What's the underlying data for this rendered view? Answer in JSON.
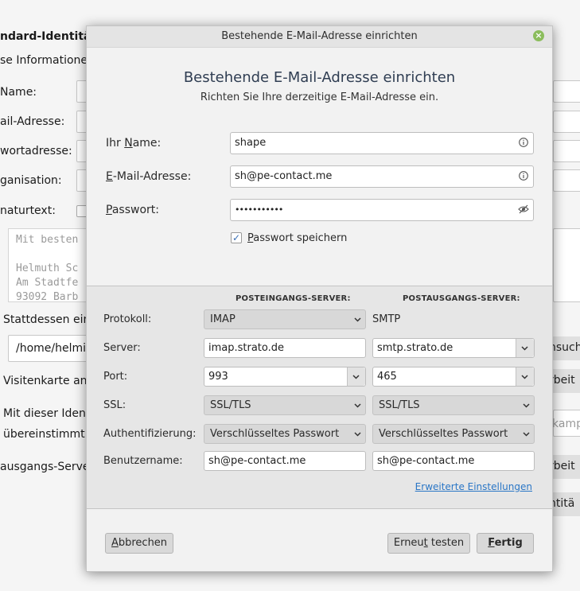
{
  "background": {
    "section_title": "ndard-Identitä",
    "section_subtitle": "se Informationen",
    "labels": {
      "name": "Name:",
      "email": "ail-Adresse:",
      "reply": "wortadresse:",
      "org": "ganisation:",
      "signature": "naturtext:"
    },
    "signature_lines": [
      "Mit besten",
      "",
      "Helmuth Sc",
      "Am Stadtfe",
      "93092 Barb"
    ],
    "instead_label": "Stattdessen ein",
    "path_value": "/home/helmi/",
    "browse_button": "nsuch",
    "vcard_label": "Visitenkarte an",
    "edit_button_1": "rbeit",
    "with_identity_line1": "Mit dieser Ident",
    "with_identity_line2": "übereinstimmt",
    "placeholder_right": "kamp",
    "outgoing_label": "ausgangs-Serve",
    "edit_button_2": "rbeit",
    "identities_button": "ntitä"
  },
  "dialog": {
    "window_title": "Bestehende E-Mail-Adresse einrichten",
    "heading": "Bestehende E-Mail-Adresse einrichten",
    "subheading": "Richten Sie Ihre derzeitige E-Mail-Adresse ein.",
    "fields": {
      "name_label_pre": "Ihr ",
      "name_label_u": "N",
      "name_label_post": "ame:",
      "name_value": "shape",
      "email_label_u": "E",
      "email_label_post": "-Mail-Adresse:",
      "email_value": "sh@pe-contact.me",
      "password_label_u": "P",
      "password_label_post": "asswort:",
      "password_value": "•••••••••••"
    },
    "remember_password": {
      "checked": true,
      "label_u": "P",
      "label_post": "asswort speichern"
    },
    "server": {
      "incoming_header": "POSTEINGANGS-SERVER:",
      "outgoing_header": "POSTAUSGANGS-SERVER:",
      "labels": {
        "protocol": "Protokoll:",
        "server": "Server:",
        "port": "Port:",
        "ssl": "SSL:",
        "auth": "Authentifizierung:",
        "username": "Benutzername:"
      },
      "incoming": {
        "protocol": "IMAP",
        "server": "imap.strato.de",
        "port": "993",
        "ssl": "SSL/TLS",
        "auth": "Verschlüsseltes Passwort",
        "username": "sh@pe-contact.me"
      },
      "outgoing": {
        "protocol": "SMTP",
        "server": "smtp.strato.de",
        "port": "465",
        "ssl": "SSL/TLS",
        "auth": "Verschlüsseltes Passwort",
        "username": "sh@pe-contact.me"
      },
      "advanced_link": "Erweiterte Einstellungen"
    },
    "buttons": {
      "cancel_u": "A",
      "cancel_post": "bbrechen",
      "retest_pre": "Erneu",
      "retest_u": "t",
      "retest_post": " testen",
      "done_u": "F",
      "done_post": "ertig"
    }
  }
}
